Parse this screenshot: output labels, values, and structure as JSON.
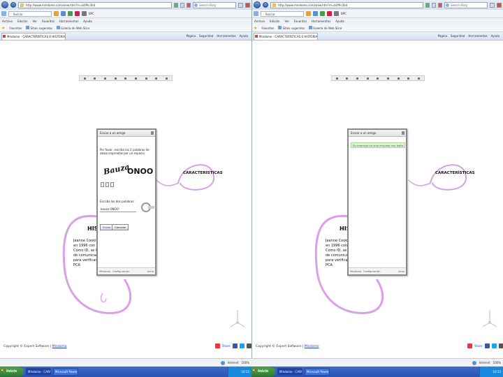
{
  "browser": {
    "address": "http://www.mindomo.com/view.htm?m=b0f9c3b4",
    "search_placeholder": "Search Bing",
    "toolbar_input": "Buscar",
    "toolbar_text": "BPC",
    "menu": [
      "Archivo",
      "Edición",
      "Ver",
      "Favoritos",
      "Herramientas",
      "Ayuda"
    ],
    "fav_label": "Favoritos",
    "fav_links": [
      "Sitios sugeridos",
      "Galería de Web Slice"
    ],
    "tab_title": "Mindomo - CARACTERÍSTICAS E HISTÓRIA",
    "commands": [
      "Página",
      "Seguridad",
      "Herramientas",
      "Ayuda"
    ],
    "status_zone": "Internet",
    "status_zoom": "100%"
  },
  "page": {
    "node_car": "CARACTERÍSTICAS",
    "node_hist": "HIST",
    "body_lines": [
      "Jeanne Cooking Fo",
      "en 1996 con la co",
      "Como ID, se le ll",
      "de comunicacion",
      "para verificar la",
      "PCA"
    ],
    "footer_prefix": "Copyright © Expert Software | ",
    "footer_link": "Mindomo",
    "share_label": "Share"
  },
  "dialog_left": {
    "title": "Enviar a un amigo",
    "prompt": "Por favor, escriba las 2 palabras de abajo separadas por un espacio",
    "captcha_word1": "Bauza",
    "captcha_word2": "ONOO'",
    "input_label": "Escriba las dos palabras:",
    "input_value": "bauza ONOO'",
    "send": "Enviar",
    "cancel": "Cancelar",
    "foot_left": "Mindomo",
    "foot_mid": "Configuración",
    "foot_right": "Inicio"
  },
  "dialog_right": {
    "title": "Enviar a un amigo",
    "success": "Su mensaje ha sido enviado con éxito.",
    "foot_left": "Mindomo",
    "foot_mid": "Configuración",
    "foot_right": "Inicio"
  },
  "taskbar": {
    "start": "Inicio",
    "tasks": [
      "Mindomo - CARACTE...",
      "Microsoft PowerPoint..."
    ],
    "tray_time": "10:35"
  },
  "colors": {
    "mindmap_stroke": "#d9a0e6",
    "success_bg": "#dff3d6"
  }
}
